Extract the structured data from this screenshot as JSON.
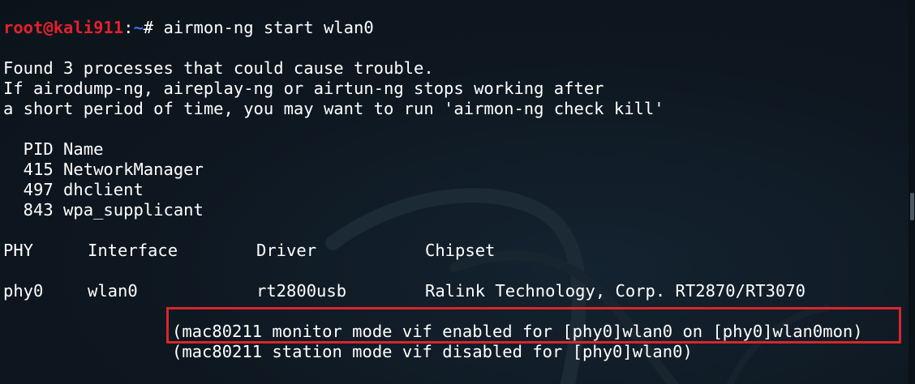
{
  "prompt": {
    "user_host": "root@kali911",
    "separator": ":",
    "path": "~",
    "symbol": "#",
    "command": "airmon-ng start wlan0"
  },
  "messages": [
    "Found 3 processes that could cause trouble.",
    "If airodump-ng, aireplay-ng or airtun-ng stops working after",
    "a short period of time, you may want to run 'airmon-ng check kill'"
  ],
  "processes": {
    "header": "  PID Name",
    "rows": [
      "  415 NetworkManager",
      "  497 dhclient",
      "  843 wpa_supplicant"
    ]
  },
  "interface_table": {
    "columns": [
      "PHY",
      "Interface",
      "Driver",
      "Chipset"
    ],
    "row": {
      "phy": "phy0",
      "interface": "wlan0",
      "driver": "rt2800usb",
      "chipset": "Ralink Technology, Corp. RT2870/RT3070"
    }
  },
  "notes": [
    "(mac80211 monitor mode vif enabled for [phy0]wlan0 on [phy0]wlan0mon)",
    "(mac80211 station mode vif disabled for [phy0]wlan0)"
  ],
  "colors": {
    "background": "#0f1820",
    "text": "#ffffff",
    "prompt_user": "#e4202c",
    "prompt_path": "#3d6ef0",
    "highlight_box": "#d9262b"
  }
}
